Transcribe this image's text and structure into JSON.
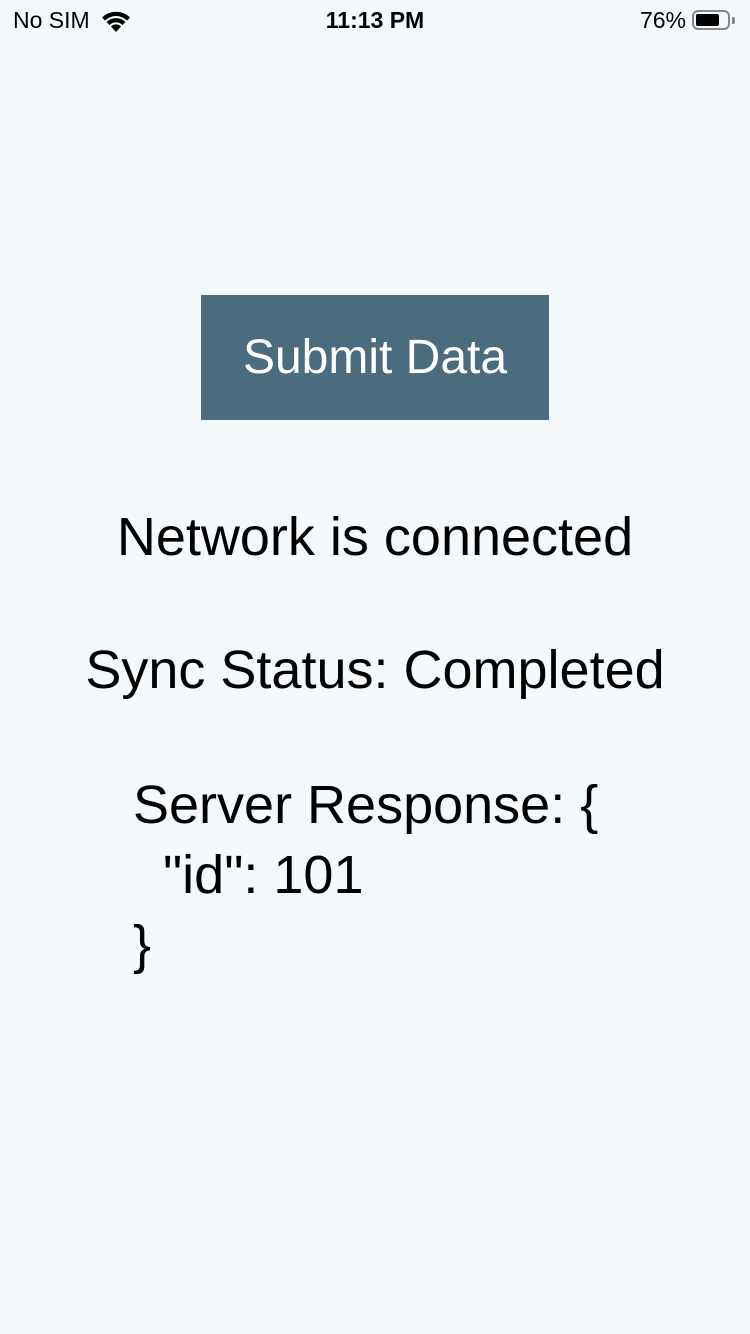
{
  "status_bar": {
    "carrier": "No SIM",
    "time": "11:13 PM",
    "battery_percent_text": "76%",
    "battery_level": 0.76,
    "wifi_icon": "wifi-icon",
    "battery_icon": "battery-icon"
  },
  "actions": {
    "submit_label": "Submit Data",
    "submit_color": "#4b6c7f"
  },
  "status": {
    "network": "Network is connected",
    "sync": "Sync Status: Completed"
  },
  "server_response": {
    "line1": "Server Response: {",
    "line2": "  \"id\": 101",
    "line3": "}"
  },
  "colors": {
    "background": "#f5f9fc"
  }
}
